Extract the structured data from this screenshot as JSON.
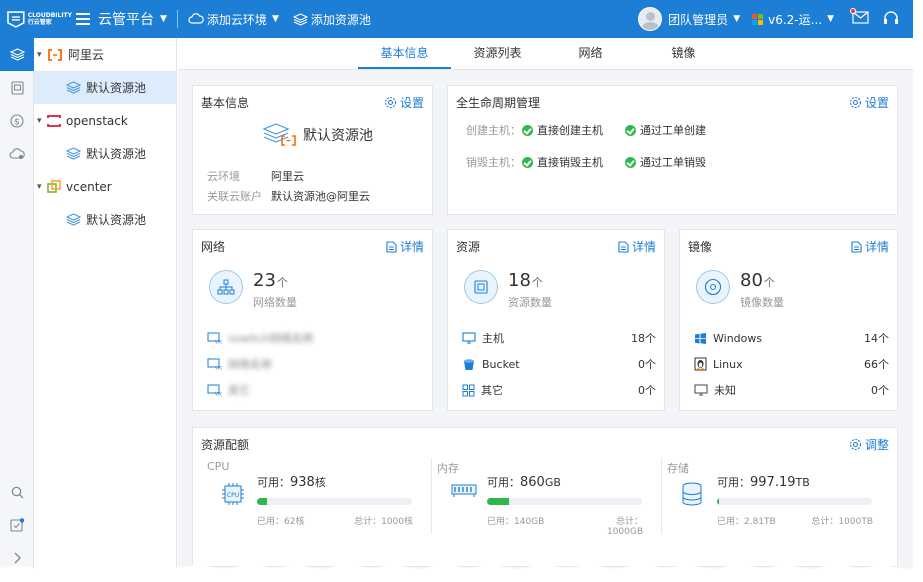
{
  "topbar": {
    "logo_text": "CLOUDBILITY",
    "logo_sub": "行云管家",
    "brand": "云管平台",
    "nav_add_env": "添加云环境",
    "nav_add_pool": "添加资源池",
    "user": "团队管理员",
    "version": "v6.2-运..."
  },
  "tree": {
    "items": [
      {
        "label": "阿里云",
        "icon": "aliyun-icon"
      },
      {
        "label": "默认资源池",
        "icon": "layers-icon"
      },
      {
        "label": "openstack",
        "icon": "openstack-icon"
      },
      {
        "label": "默认资源池",
        "icon": "layers-icon"
      },
      {
        "label": "vcenter",
        "icon": "vcenter-icon"
      },
      {
        "label": "默认资源池",
        "icon": "layers-icon"
      }
    ]
  },
  "tabs": [
    "基本信息",
    "资源列表",
    "网络",
    "镜像"
  ],
  "basic": {
    "title": "基本信息",
    "settings": "设置",
    "pool_name": "默认资源池",
    "cloud_env_key": "云环境",
    "cloud_env_val": "阿里云",
    "account_key": "关联云账户",
    "account_val": "默认资源池@阿里云"
  },
  "lifecycle": {
    "title": "全生命周期管理",
    "settings": "设置",
    "create_key": "创建主机：",
    "create_a": "直接创建主机",
    "create_b": "通过工单创建",
    "destroy_key": "销毁主机：",
    "destroy_a": "直接销毁主机",
    "destroy_b": "通过工单销毁"
  },
  "network": {
    "title": "网络",
    "detail": "详情",
    "count": "23",
    "unit": "个",
    "caption": "网络数量",
    "items": [
      "vswitch网络名称",
      "网络名称",
      "其它"
    ]
  },
  "resources": {
    "title": "资源",
    "detail": "详情",
    "count": "18",
    "unit": "个",
    "caption": "资源数量",
    "items": [
      {
        "label": "主机",
        "count": "18个"
      },
      {
        "label": "Bucket",
        "count": "0个"
      },
      {
        "label": "其它",
        "count": "0个"
      }
    ]
  },
  "images": {
    "title": "镜像",
    "detail": "详情",
    "count": "80",
    "unit": "个",
    "caption": "镜像数量",
    "items": [
      {
        "label": "Windows",
        "count": "14个"
      },
      {
        "label": "Linux",
        "count": "66个"
      },
      {
        "label": "未知",
        "count": "0个"
      }
    ]
  },
  "quota": {
    "title": "资源配额",
    "adjust": "调整",
    "cpu": {
      "title": "CPU",
      "avail_label": "可用：",
      "avail": "938",
      "unit": "核",
      "used": "已用：62核",
      "total": "总计：1000核",
      "fraction": 0.062
    },
    "mem": {
      "title": "内存",
      "avail_label": "可用：",
      "avail": "860",
      "unit": "GB",
      "used": "已用：140GB",
      "total": "总计：1000GB",
      "fraction": 0.14
    },
    "storage": {
      "title": "存储",
      "avail_label": "可用：",
      "avail": "997.19",
      "unit": "TB",
      "used": "已用：2.81TB",
      "total": "总计：1000TB",
      "fraction": 0.00281
    }
  },
  "colors": {
    "accent": "#1d7ed6",
    "success": "#2db84d",
    "aliyun": "#ff6a00"
  }
}
